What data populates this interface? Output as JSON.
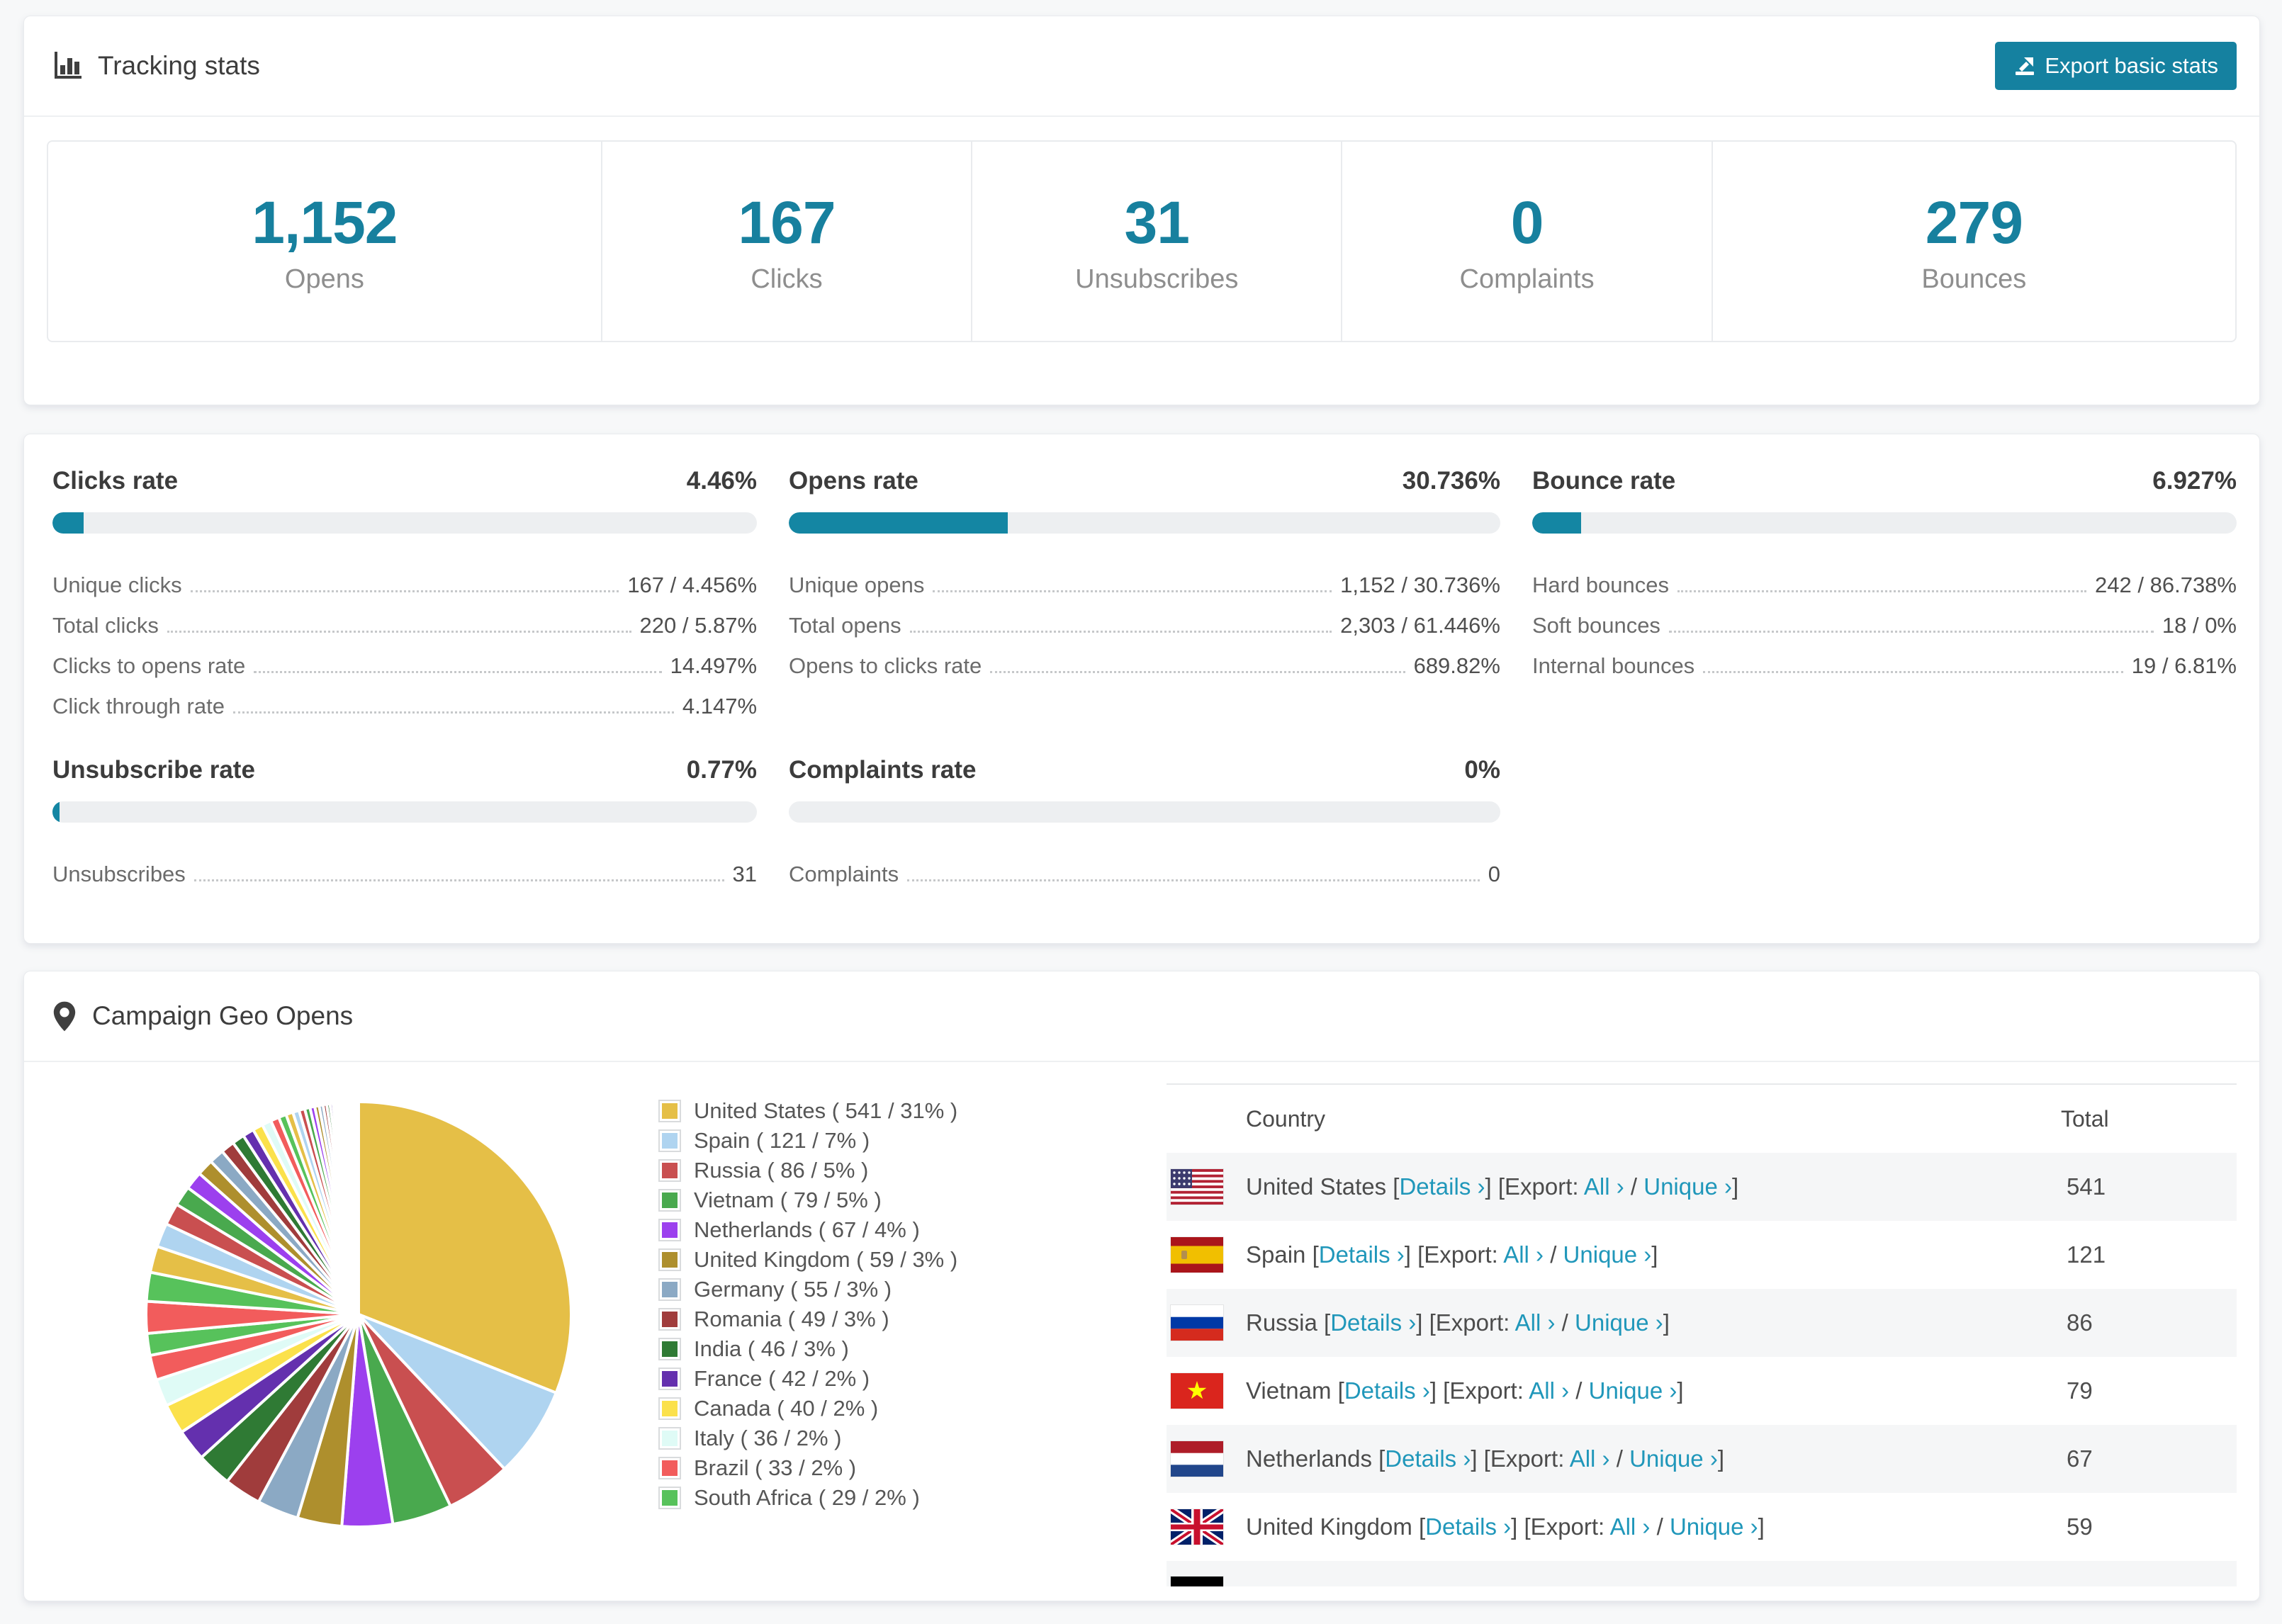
{
  "colors": {
    "accent": "#17809E",
    "button": "#1581A0",
    "bar_fill": "#1486A3",
    "bar_track": "#EDEFF1",
    "link": "#2097BA",
    "page_bg": "#F7F8F9",
    "row_stripe": "#F5F6F7"
  },
  "tracking": {
    "title": "Tracking stats",
    "export_button": "Export basic stats",
    "summary": [
      {
        "value": "1,152",
        "label": "Opens"
      },
      {
        "value": "167",
        "label": "Clicks"
      },
      {
        "value": "31",
        "label": "Unsubscribes"
      },
      {
        "value": "0",
        "label": "Complaints"
      },
      {
        "value": "279",
        "label": "Bounces"
      }
    ]
  },
  "rates": [
    {
      "id": "clicks",
      "title": "Clicks rate",
      "value": "4.46%",
      "percent": 4.46,
      "rows": [
        {
          "label": "Unique clicks",
          "value": "167 / 4.456%"
        },
        {
          "label": "Total clicks",
          "value": "220 / 5.87%"
        },
        {
          "label": "Clicks to opens rate",
          "value": "14.497%"
        },
        {
          "label": "Click through rate",
          "value": "4.147%"
        }
      ]
    },
    {
      "id": "opens",
      "title": "Opens rate",
      "value": "30.736%",
      "percent": 30.736,
      "rows": [
        {
          "label": "Unique opens",
          "value": "1,152 / 30.736%"
        },
        {
          "label": "Total opens",
          "value": "2,303 / 61.446%"
        },
        {
          "label": "Opens to clicks rate",
          "value": "689.82%"
        }
      ]
    },
    {
      "id": "bounce",
      "title": "Bounce rate",
      "value": "6.927%",
      "percent": 6.927,
      "rows": [
        {
          "label": "Hard bounces",
          "value": "242 / 86.738%"
        },
        {
          "label": "Soft bounces",
          "value": "18 / 0%"
        },
        {
          "label": "Internal bounces",
          "value": "19 / 6.81%"
        }
      ]
    },
    {
      "id": "unsubscribe",
      "title": "Unsubscribe rate",
      "value": "0.77%",
      "percent": 0.77,
      "rows": [
        {
          "label": "Unsubscribes",
          "value": "31"
        }
      ]
    },
    {
      "id": "complaints",
      "title": "Complaints rate",
      "value": "0%",
      "percent": 0,
      "rows": [
        {
          "label": "Complaints",
          "value": "0"
        }
      ]
    }
  ],
  "geo": {
    "title": "Campaign Geo Opens",
    "legend": [
      {
        "label": "United States ( 541 / 31% )",
        "color": "#E5BF47"
      },
      {
        "label": "Spain ( 121 / 7% )",
        "color": "#AFD4F0"
      },
      {
        "label": "Russia ( 86 / 5% )",
        "color": "#C94F50"
      },
      {
        "label": "Vietnam ( 79 / 5% )",
        "color": "#49A94E"
      },
      {
        "label": "Netherlands ( 67 / 4% )",
        "color": "#9C40EE"
      },
      {
        "label": "United Kingdom ( 59 / 3% )",
        "color": "#AE8F2D"
      },
      {
        "label": "Germany ( 55 / 3% )",
        "color": "#8BA9C4"
      },
      {
        "label": "Romania ( 49 / 3% )",
        "color": "#A03C3C"
      },
      {
        "label": "India ( 46 / 3% )",
        "color": "#2F7A34"
      },
      {
        "label": "France ( 42 / 2% )",
        "color": "#6430AE"
      },
      {
        "label": "Canada ( 40 / 2% )",
        "color": "#FBE14B"
      },
      {
        "label": "Italy ( 36 / 2% )",
        "color": "#DFFBF6"
      },
      {
        "label": "Brazil ( 33 / 2% )",
        "color": "#F25C5C"
      },
      {
        "label": "South Africa ( 29 / 2% )",
        "color": "#57C25B"
      }
    ],
    "table": {
      "columns": [
        "Country",
        "Total"
      ],
      "links": {
        "details": "Details ›",
        "export_prefix": "Export:",
        "all": "All ›",
        "unique": "Unique ›"
      },
      "rows": [
        {
          "country": "United States",
          "flag": "us",
          "total": "541"
        },
        {
          "country": "Spain",
          "flag": "es",
          "total": "121"
        },
        {
          "country": "Russia",
          "flag": "ru",
          "total": "86"
        },
        {
          "country": "Vietnam",
          "flag": "vn",
          "total": "79"
        },
        {
          "country": "Netherlands",
          "flag": "nl",
          "total": "67"
        },
        {
          "country": "United Kingdom",
          "flag": "gb",
          "total": "59"
        }
      ],
      "partial_row": {
        "flag": "de"
      }
    },
    "chart_data": {
      "type": "pie",
      "title": "Campaign Geo Opens",
      "categories": [
        "United States",
        "Spain",
        "Russia",
        "Vietnam",
        "Netherlands",
        "United Kingdom",
        "Germany",
        "Romania",
        "India",
        "France",
        "Canada",
        "Italy",
        "Brazil",
        "South Africa"
      ],
      "values": [
        541,
        121,
        86,
        79,
        67,
        59,
        55,
        49,
        46,
        42,
        40,
        36,
        33,
        29
      ],
      "percent_labels": [
        31,
        7,
        5,
        5,
        4,
        3,
        3,
        3,
        3,
        2,
        2,
        2,
        2,
        2
      ],
      "colors": [
        "#E5BF47",
        "#AFD4F0",
        "#C94F50",
        "#49A94E",
        "#9C40EE",
        "#AE8F2D",
        "#8BA9C4",
        "#A03C3C",
        "#2F7A34",
        "#6430AE",
        "#FBE14B",
        "#DFFBF6",
        "#F25C5C",
        "#57C25B"
      ],
      "pie_total_units": 1744,
      "unlabeled_tail": {
        "slice_count": 44,
        "percent": 26.4,
        "decay": 0.91
      },
      "start_angle_deg": -90,
      "direction": "clockwise",
      "legend_position": "right"
    }
  }
}
